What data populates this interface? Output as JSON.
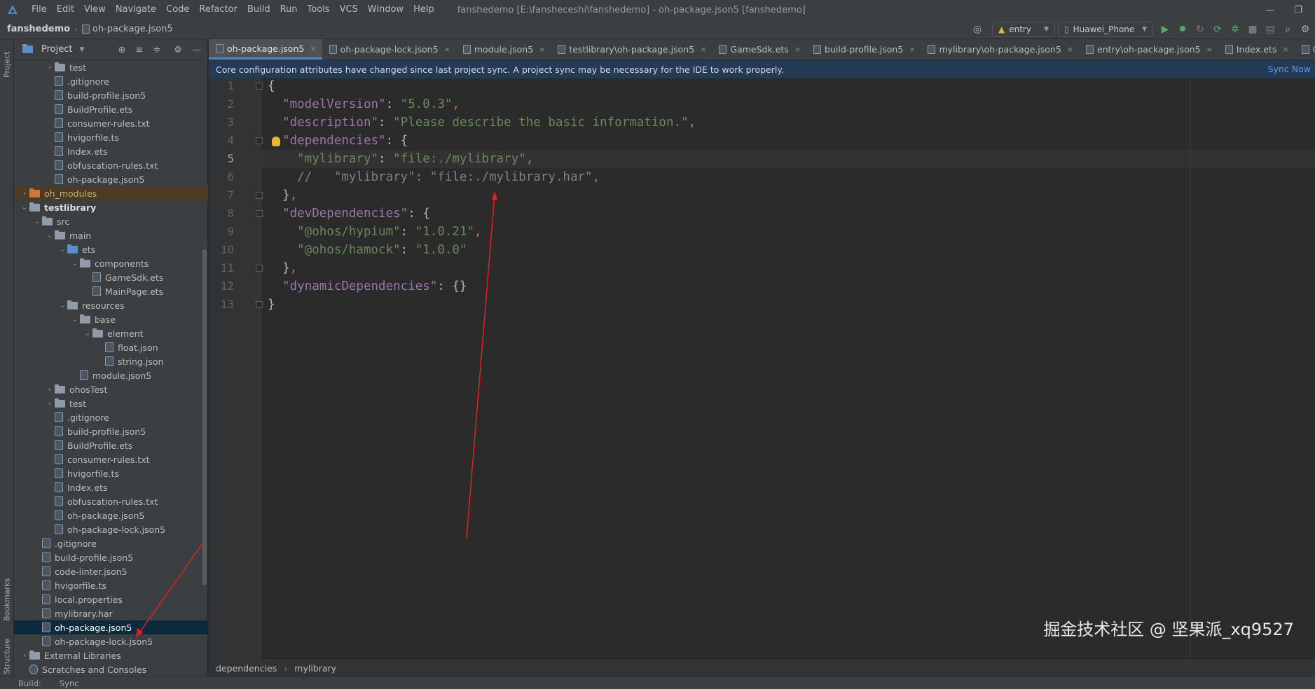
{
  "menubar": {
    "items": [
      "File",
      "Edit",
      "View",
      "Navigate",
      "Code",
      "Refactor",
      "Build",
      "Run",
      "Tools",
      "VCS",
      "Window",
      "Help"
    ],
    "window_title": "fanshedemo [E:\\fansheceshi\\fanshedemo] - oh-package.json5 [fanshedemo]",
    "minimize": "—",
    "restore": "❐"
  },
  "navbar": {
    "project": "fanshedemo",
    "separator": "›",
    "file": "oh-package.json5",
    "module_select": "entry",
    "device_select": "Huawei_Phone"
  },
  "left_strip": {
    "project_label": "Project",
    "bookmarks_label": "Bookmarks",
    "structure_label": "Structure"
  },
  "project_panel": {
    "title": "Project",
    "tree": [
      {
        "label": "test",
        "type": "folder",
        "level": 3,
        "chevron": "›"
      },
      {
        "label": ".gitignore",
        "type": "file",
        "level": 3
      },
      {
        "label": "build-profile.json5",
        "type": "file",
        "level": 3
      },
      {
        "label": "BuildProfile.ets",
        "type": "file",
        "level": 3
      },
      {
        "label": "consumer-rules.txt",
        "type": "file",
        "level": 3
      },
      {
        "label": "hvigorfile.ts",
        "type": "file",
        "level": 3
      },
      {
        "label": "Index.ets",
        "type": "file",
        "level": 3
      },
      {
        "label": "obfuscation-rules.txt",
        "type": "file",
        "level": 3
      },
      {
        "label": "oh-package.json5",
        "type": "file",
        "level": 3
      },
      {
        "label": "oh_modules",
        "type": "folder-orange",
        "level": 1,
        "chevron": "›",
        "state": "excluded"
      },
      {
        "label": "testlibrary",
        "type": "folder",
        "level": 1,
        "chevron": "⌄",
        "state": "bold"
      },
      {
        "label": "src",
        "type": "folder",
        "level": 2,
        "chevron": "⌄"
      },
      {
        "label": "main",
        "type": "folder",
        "level": 3,
        "chevron": "⌄"
      },
      {
        "label": "ets",
        "type": "folder-blue",
        "level": 4,
        "chevron": "⌄"
      },
      {
        "label": "components",
        "type": "folder",
        "level": 5,
        "chevron": "⌄"
      },
      {
        "label": "GameSdk.ets",
        "type": "file",
        "level": 6
      },
      {
        "label": "MainPage.ets",
        "type": "file",
        "level": 6
      },
      {
        "label": "resources",
        "type": "folder",
        "level": 4,
        "chevron": "⌄"
      },
      {
        "label": "base",
        "type": "folder",
        "level": 5,
        "chevron": "⌄"
      },
      {
        "label": "element",
        "type": "folder",
        "level": 6,
        "chevron": "⌄"
      },
      {
        "label": "float.json",
        "type": "file",
        "level": 7
      },
      {
        "label": "string.json",
        "type": "file",
        "level": 7
      },
      {
        "label": "module.json5",
        "type": "file",
        "level": 5
      },
      {
        "label": "ohosTest",
        "type": "folder",
        "level": 3,
        "chevron": "›"
      },
      {
        "label": "test",
        "type": "folder",
        "level": 3,
        "chevron": "›"
      },
      {
        "label": ".gitignore",
        "type": "file",
        "level": 3
      },
      {
        "label": "build-profile.json5",
        "type": "file",
        "level": 3
      },
      {
        "label": "BuildProfile.ets",
        "type": "file",
        "level": 3
      },
      {
        "label": "consumer-rules.txt",
        "type": "file",
        "level": 3
      },
      {
        "label": "hvigorfile.ts",
        "type": "file",
        "level": 3
      },
      {
        "label": "Index.ets",
        "type": "file",
        "level": 3
      },
      {
        "label": "obfuscation-rules.txt",
        "type": "file",
        "level": 3
      },
      {
        "label": "oh-package.json5",
        "type": "file",
        "level": 3
      },
      {
        "label": "oh-package-lock.json5",
        "type": "file",
        "level": 3
      },
      {
        "label": ".gitignore",
        "type": "file",
        "level": 2
      },
      {
        "label": "build-profile.json5",
        "type": "file",
        "level": 2
      },
      {
        "label": "code-linter.json5",
        "type": "file",
        "level": 2
      },
      {
        "label": "hvigorfile.ts",
        "type": "file",
        "level": 2
      },
      {
        "label": "local.properties",
        "type": "file",
        "level": 2
      },
      {
        "label": "mylibrary.har",
        "type": "file",
        "level": 2
      },
      {
        "label": "oh-package.json5",
        "type": "file",
        "level": 2,
        "state": "selected"
      },
      {
        "label": "oh-package-lock.json5",
        "type": "file",
        "level": 2
      },
      {
        "label": "External Libraries",
        "type": "lib",
        "level": 1,
        "chevron": "›"
      },
      {
        "label": "Scratches and Consoles",
        "type": "scratch",
        "level": 1
      }
    ]
  },
  "tabs": [
    {
      "label": "oh-package.json5",
      "active": true
    },
    {
      "label": "oh-package-lock.json5"
    },
    {
      "label": "module.json5"
    },
    {
      "label": "testlibrary\\oh-package.json5"
    },
    {
      "label": "GameSdk.ets"
    },
    {
      "label": "build-profile.json5"
    },
    {
      "label": "mylibrary\\oh-package.json5"
    },
    {
      "label": "entry\\oh-package.json5"
    },
    {
      "label": "Index.ets"
    },
    {
      "label": "Calc.et"
    }
  ],
  "tab_close": "×",
  "notice": {
    "text": "Core configuration attributes have changed since last project sync. A project sync may be necessary for the IDE to work properly.",
    "action": "Sync Now"
  },
  "editor": {
    "current_line": 5,
    "lines": [
      {
        "n": "1",
        "parts": [
          [
            "p0",
            "{"
          ]
        ]
      },
      {
        "n": "2",
        "parts": [
          [
            "k",
            "  \"modelVersion\""
          ],
          [
            "p0",
            ": "
          ],
          [
            "s",
            "\"5.0.3\""
          ],
          [
            "p",
            ","
          ]
        ]
      },
      {
        "n": "3",
        "parts": [
          [
            "k",
            "  \"description\""
          ],
          [
            "p0",
            ": "
          ],
          [
            "s",
            "\"Please describe the basic information.\""
          ],
          [
            "p",
            ","
          ]
        ]
      },
      {
        "n": "4",
        "parts": [
          [
            "k",
            "  \"dependencies\""
          ],
          [
            "p0",
            ": {"
          ]
        ]
      },
      {
        "n": "5",
        "parts": [
          [
            "s",
            "    \"mylibrary\""
          ],
          [
            "p0",
            ": "
          ],
          [
            "s",
            "\"file:./mylibrary\""
          ],
          [
            "p",
            ","
          ]
        ]
      },
      {
        "n": "6",
        "parts": [
          [
            "c",
            "    //   \"mylibrary\": \"file:./mylibrary.har\","
          ]
        ]
      },
      {
        "n": "7",
        "parts": [
          [
            "p0",
            "  }"
          ],
          [
            "p",
            ","
          ]
        ]
      },
      {
        "n": "8",
        "parts": [
          [
            "k",
            "  \"devDependencies\""
          ],
          [
            "p0",
            ": {"
          ]
        ]
      },
      {
        "n": "9",
        "parts": [
          [
            "s",
            "    \"@ohos/hypium\""
          ],
          [
            "p0",
            ": "
          ],
          [
            "s",
            "\"1.0.21\""
          ],
          [
            "p",
            ","
          ]
        ]
      },
      {
        "n": "10",
        "parts": [
          [
            "s",
            "    \"@ohos/hamock\""
          ],
          [
            "p0",
            ": "
          ],
          [
            "s",
            "\"1.0.0\""
          ]
        ]
      },
      {
        "n": "11",
        "parts": [
          [
            "p0",
            "  }"
          ],
          [
            "p",
            ","
          ]
        ]
      },
      {
        "n": "12",
        "parts": [
          [
            "k",
            "  \"dynamicDependencies\""
          ],
          [
            "p0",
            ": {}"
          ]
        ]
      },
      {
        "n": "13",
        "parts": [
          [
            "p0",
            "}"
          ]
        ]
      }
    ]
  },
  "breadcrumb": {
    "items": [
      "dependencies",
      "mylibrary"
    ],
    "separator": "›"
  },
  "watermark": "掘金技术社区 @ 坚果派_xq9527",
  "statusbar": {
    "build": "Build:",
    "sync": "Sync"
  },
  "colors": {
    "accent": "#4a88c7",
    "annotation_arrow": "#e02020"
  }
}
